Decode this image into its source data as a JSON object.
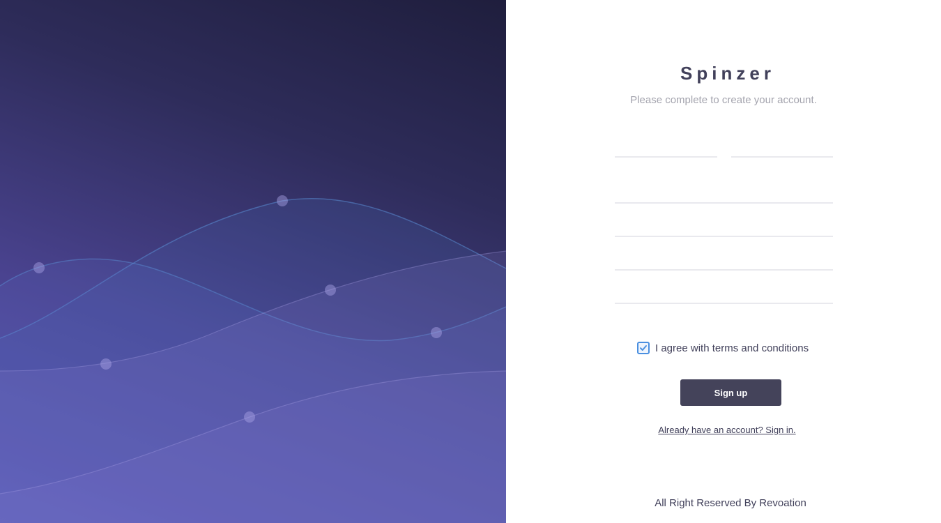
{
  "brand": {
    "name": "Spinzer"
  },
  "form": {
    "subtitle": "Please complete to create your account.",
    "fields": [
      {
        "name": "first-name",
        "value": "",
        "placeholder": ""
      },
      {
        "name": "last-name",
        "value": "",
        "placeholder": ""
      },
      {
        "name": "field-1",
        "value": "",
        "placeholder": ""
      },
      {
        "name": "field-2",
        "value": "",
        "placeholder": ""
      },
      {
        "name": "field-3",
        "value": "",
        "placeholder": ""
      },
      {
        "name": "field-4",
        "value": "",
        "placeholder": ""
      }
    ],
    "agree_label": "I agree with terms and conditions",
    "agree_checked": true,
    "signup_label": "Sign up",
    "signin_link": "Already have an account? Sign in."
  },
  "footer": {
    "text": "All Right Reserved By Revoation"
  },
  "colors": {
    "accent": "#44435a",
    "checkbox": "#4a8fe0",
    "hero_dark": "#1f1e3d",
    "hero_light": "#5c55b4"
  }
}
